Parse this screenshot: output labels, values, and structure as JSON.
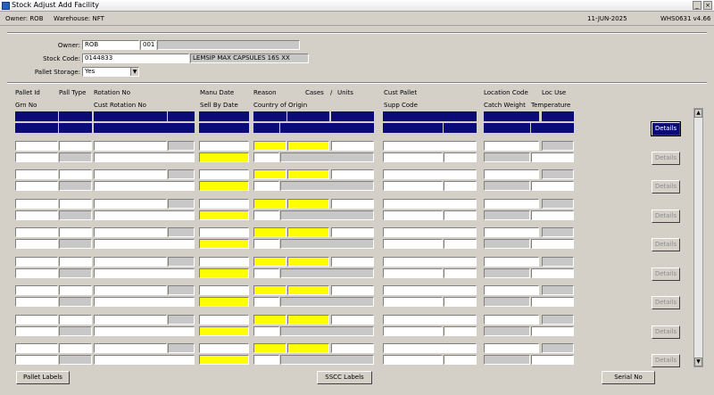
{
  "window": {
    "title": "Stock Adjust Add Facility",
    "min_label": "_",
    "close_label": "×"
  },
  "info": {
    "owner": "Owner:  ROB",
    "warehouse": "Warehouse:  NFT",
    "date": "11-JUN-2025",
    "version": "WHS0631  v4.66"
  },
  "header": {
    "owner_label": "Owner:",
    "owner_value": "ROB",
    "owner_code": "001",
    "owner_desc": "",
    "stock_code_label": "Stock Code:",
    "stock_code_value": "0144833",
    "stock_desc": "LEMSIP MAX CAPSULES 16S XX",
    "pallet_storage_label": "Pallet Storage:",
    "pallet_storage_value": "Yes"
  },
  "columns": {
    "pallet_id": "Pallet Id",
    "pall_type": "Pall Type",
    "rotation_no": "Rotation No",
    "grn_no": "Grn No",
    "cust_rotation_no": "Cust Rotation No",
    "manu_date": "Manu Date",
    "sell_by_date": "Sell By Date",
    "reason": "Reason",
    "cases": "Cases",
    "slash": "/",
    "units": "Units",
    "country_of_origin": "Country of Origin",
    "cust_pallet": "Cust Pallet",
    "supp_code": "Supp Code",
    "location_code": "Location Code",
    "loc_use": "Loc Use",
    "catch_weight": "Catch Weight",
    "temperature": "Temperature"
  },
  "rows": [
    {
      "details_label": "Details",
      "state": "active"
    },
    {
      "details_label": "Details",
      "state": "disabled"
    },
    {
      "details_label": "Details",
      "state": "disabled"
    },
    {
      "details_label": "Details",
      "state": "disabled"
    },
    {
      "details_label": "Details",
      "state": "disabled"
    },
    {
      "details_label": "Details",
      "state": "disabled"
    },
    {
      "details_label": "Details",
      "state": "disabled"
    },
    {
      "details_label": "Details",
      "state": "disabled"
    },
    {
      "details_label": "Details",
      "state": "disabled"
    }
  ],
  "footer": {
    "pallet_labels": "Pallet Labels",
    "sscc_labels": "SSCC Labels",
    "serial_no": "Serial No"
  },
  "colors": {
    "navy": "#0b0b78",
    "yellow": "#ffff00",
    "readonly": "#c8c8c8"
  }
}
